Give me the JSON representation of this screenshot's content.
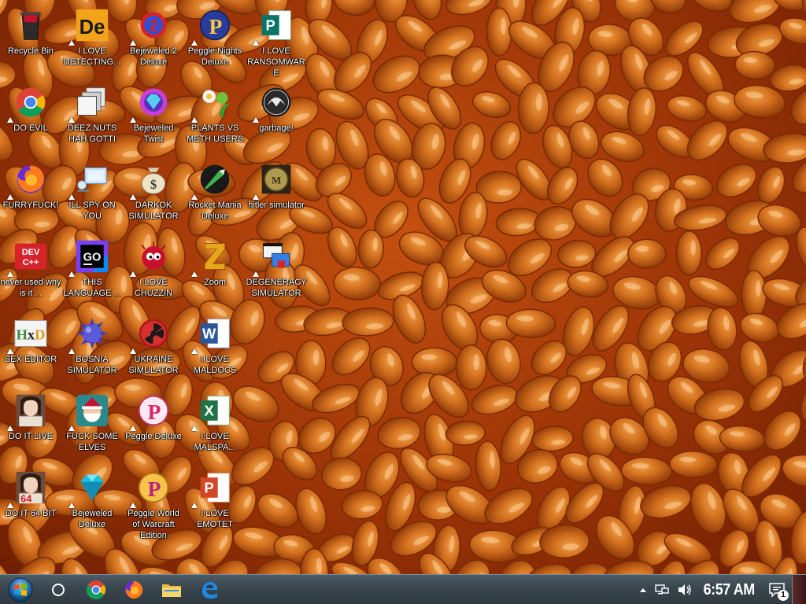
{
  "desktop": {
    "icons": [
      {
        "label": "Recycle Bin",
        "icon": "recycle-bin-icon",
        "shortcut": false
      },
      {
        "label": "DO EVIL",
        "icon": "chrome-icon",
        "shortcut": true
      },
      {
        "label": "FURRYFUCK!",
        "icon": "firefox-icon",
        "shortcut": true
      },
      {
        "label": "never used why is it ...",
        "icon": "devcpp-icon",
        "shortcut": true
      },
      {
        "label": "SEX EDITOR",
        "icon": "hxd-icon",
        "shortcut": true
      },
      {
        "label": "DO IT LIVE",
        "icon": "portrait-icon",
        "shortcut": true
      },
      {
        "label": "DO IT 64 BIT",
        "icon": "portrait-64-icon",
        "shortcut": true
      },
      {
        "label": "I LOVE DETECTING...",
        "icon": "de-icon",
        "shortcut": true
      },
      {
        "label": "DEEZ NUTS HAH GOTTI",
        "icon": "stacked-windows-icon",
        "shortcut": true
      },
      {
        "label": "ILL SPY ON YOU",
        "icon": "remote-desktop-icon",
        "shortcut": true
      },
      {
        "label": "THIS LANGUAGE ...",
        "icon": "goland-icon",
        "shortcut": true
      },
      {
        "label": "BOSNIA SIMULATOR",
        "icon": "spiked-ball-icon",
        "shortcut": true
      },
      {
        "label": "FUCK SOME ELVES",
        "icon": "santa-icon",
        "shortcut": true
      },
      {
        "label": "Bejeweled Deluxe",
        "icon": "gem-icon",
        "shortcut": true
      },
      {
        "label": "Bejeweled 2 Deluxe",
        "icon": "bejeweled-2-icon",
        "shortcut": true
      },
      {
        "label": "Bejeweled Twist",
        "icon": "bejeweled-twist-icon",
        "shortcut": true
      },
      {
        "label": "DARKOK SIMULATOR",
        "icon": "money-bag-icon",
        "shortcut": true
      },
      {
        "label": "I LOVE CHUZZIN",
        "icon": "chuzzle-icon",
        "shortcut": true
      },
      {
        "label": "UKRAINE SIMULATOR",
        "icon": "radiation-icon",
        "shortcut": true
      },
      {
        "label": "Peggle Deluxe",
        "icon": "peggle-icon",
        "shortcut": true
      },
      {
        "label": "Peggle World of Warcraft Edition",
        "icon": "peggle-wow-icon",
        "shortcut": true
      },
      {
        "label": "Peggle Nights Deluxe",
        "icon": "peggle-nights-icon",
        "shortcut": true
      },
      {
        "label": "PLANTS VS METH USERS",
        "icon": "plants-icon",
        "shortcut": true
      },
      {
        "label": "Rocket Mania Deluxe",
        "icon": "rocket-icon",
        "shortcut": true
      },
      {
        "label": "Zoom",
        "icon": "zuma-icon",
        "shortcut": true
      },
      {
        "label": "I LOVE MALDOCS",
        "icon": "word-icon",
        "shortcut": true
      },
      {
        "label": "I LOVE MALSPA...",
        "icon": "excel-icon",
        "shortcut": true
      },
      {
        "label": "I LOVE EMOTET",
        "icon": "powerpoint-icon",
        "shortcut": true
      },
      {
        "label": "I LOVE RANSOMWARE",
        "icon": "publisher-icon",
        "shortcut": true
      },
      {
        "label": "garbage!",
        "icon": "biohazard-icon",
        "shortcut": true
      },
      {
        "label": "hitler simulator",
        "icon": "coin-icon",
        "shortcut": true
      },
      {
        "label": "DEGENERACY SIMULATOR",
        "icon": "windows-stack-icon",
        "shortcut": true
      }
    ]
  },
  "taskbar": {
    "start": {
      "icon": "windows-start-icon"
    },
    "pinned": [
      {
        "icon": "cortana-circle-icon",
        "name": "cortana"
      },
      {
        "icon": "chrome-icon",
        "name": "chrome"
      },
      {
        "icon": "firefox-icon",
        "name": "firefox"
      },
      {
        "icon": "file-explorer-icon",
        "name": "file-explorer"
      },
      {
        "icon": "edge-icon",
        "name": "edge"
      }
    ],
    "tray": {
      "clock": "6:57 AM",
      "notification_count": "1"
    }
  },
  "colors": {
    "taskbar": "#3a464e",
    "wallpaper": "#b4450b",
    "label": "#ffffff"
  }
}
